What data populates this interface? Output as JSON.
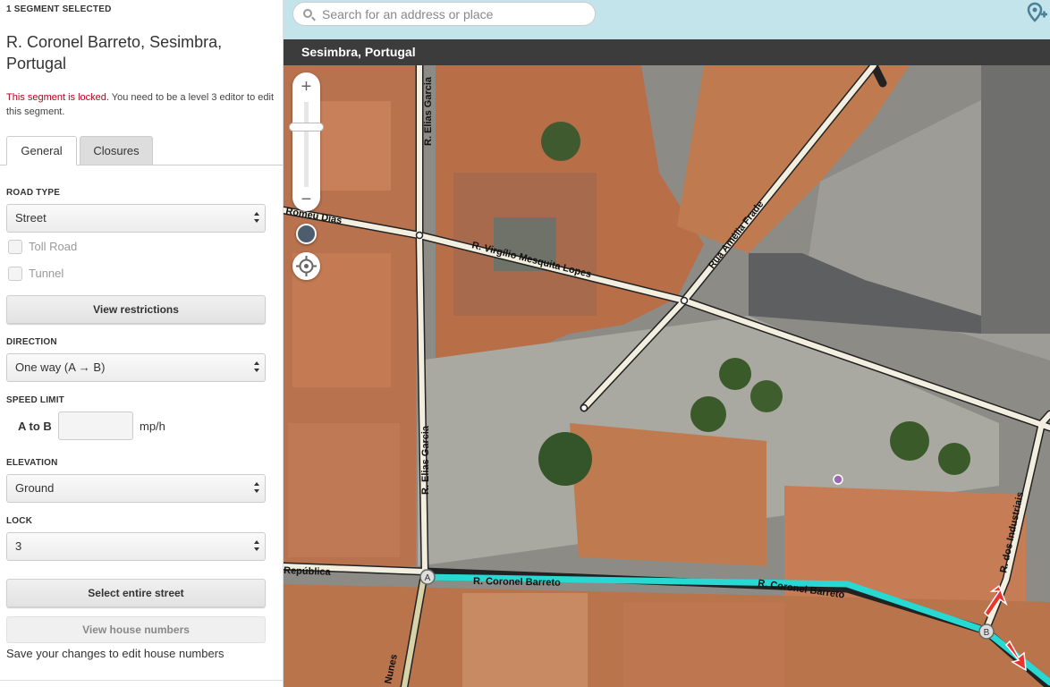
{
  "panel": {
    "selection_count": "1 SEGMENT SELECTED",
    "segment_title": "R. Coronel Barreto, Sesimbra, Portugal",
    "lock_note_red": "This segment is locked.",
    "lock_note_rest": " You need to be a level 3 editor to edit this segment.",
    "tabs": [
      {
        "label": "General"
      },
      {
        "label": "Closures"
      }
    ],
    "road_type": {
      "label": "ROAD TYPE",
      "value": "Street"
    },
    "toll_road": {
      "label": "Toll Road",
      "checked": false
    },
    "tunnel": {
      "label": "Tunnel",
      "checked": false
    },
    "view_restrictions": "View restrictions",
    "direction": {
      "label": "DIRECTION",
      "value": "One way (A → B)"
    },
    "speed_limit": {
      "label": "SPEED LIMIT",
      "ab_label": "A to B",
      "value": "",
      "unit": "mp/h"
    },
    "elevation": {
      "label": "ELEVATION",
      "value": "Ground"
    },
    "lock": {
      "label": "LOCK",
      "value": "3"
    },
    "select_street": "Select entire street",
    "view_house_numbers": "View house numbers",
    "save_note": "Save your changes to edit house numbers"
  },
  "topbar": {
    "search_placeholder": "Search for an address or place"
  },
  "map": {
    "location_title": "Sesimbra, Portugal",
    "zoom_in": "+",
    "zoom_out": "−",
    "street_labels": [
      "Romeu Dias",
      "R. Virgílio Mesquita Lopes",
      "Rua Amélia Frade",
      "R. Elias Garcia",
      "R. Elias Garcia",
      "República",
      "R. Coronel Barreto",
      "R. Coronel Barreto",
      "R. dos Industriais",
      "Nunes"
    ],
    "node_labels": [
      "A",
      "B"
    ],
    "colors": {
      "selected_segment": "#27d8d3",
      "road": "#f3efe0",
      "road_outline": "#222222",
      "turn_arrow": "#e8362e"
    }
  }
}
